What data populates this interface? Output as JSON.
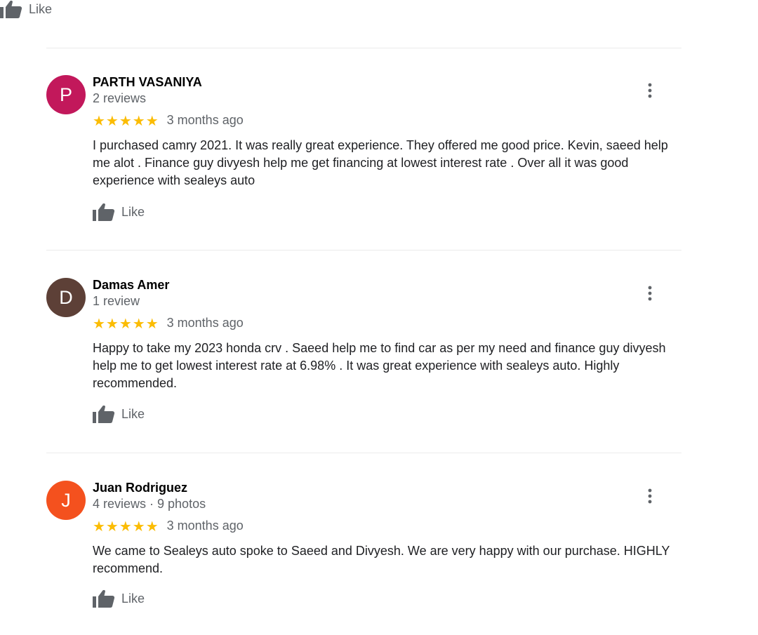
{
  "top_like": {
    "label": "Like"
  },
  "reviews": [
    {
      "avatar_letter": "P",
      "avatar_color": "#c2185b",
      "name": "PARTH VASANIYA",
      "meta": "2 reviews",
      "stars": "★★★★★",
      "rating": 5,
      "date": "3 months ago",
      "text": "I purchased camry 2021. It was really great experience. They offered me good price. Kevin, saeed help me alot . Finance guy divyesh help me get financing at lowest interest rate . Over all it was good experience with sealeys auto",
      "like_label": "Like"
    },
    {
      "avatar_letter": "D",
      "avatar_color": "#5d4037",
      "name": "Damas Amer",
      "meta": "1 review",
      "stars": "★★★★★",
      "rating": 5,
      "date": "3 months ago",
      "text": "Happy to take my 2023 honda crv . Saeed help me to find car as per my need and finance guy divyesh help me to get lowest interest rate at 6.98% . It was great experience with sealeys auto. Highly recommended.",
      "like_label": "Like"
    },
    {
      "avatar_letter": "J",
      "avatar_color": "#f4511e",
      "name": "Juan Rodriguez",
      "meta": "4 reviews · 9 photos",
      "stars": "★★★★★",
      "rating": 5,
      "date": "3 months ago",
      "text": "We came to Sealeys auto spoke to Saeed and Divyesh. We are very happy with our purchase. HIGHLY recommend.",
      "like_label": "Like"
    }
  ],
  "icons": {
    "like": "thumb-up-icon",
    "more": "more-vert-icon"
  },
  "colors": {
    "star": "#fbbc04",
    "secondary_text": "#5f6368",
    "icon": "#5f6368"
  }
}
